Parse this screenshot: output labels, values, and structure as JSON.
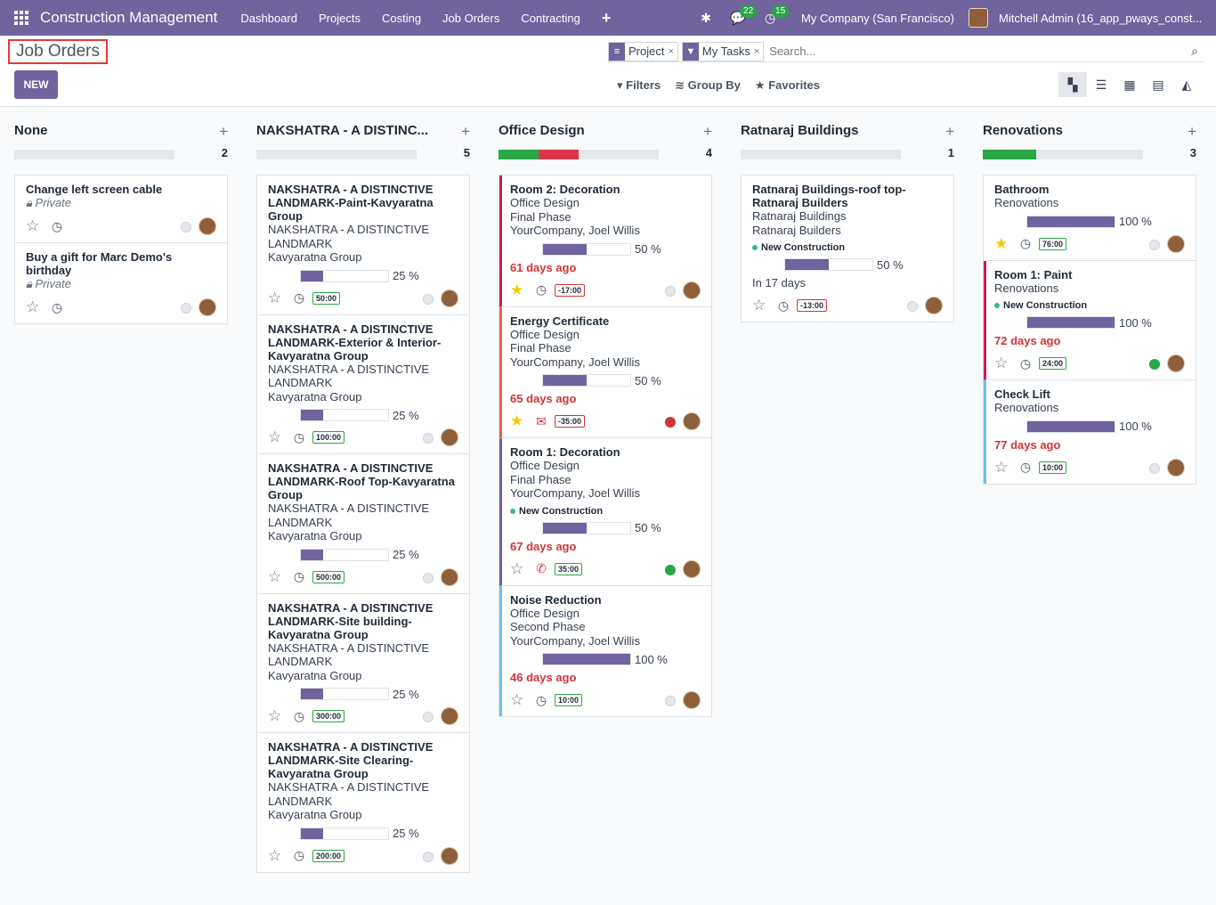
{
  "nav": {
    "app": "Construction Management",
    "menu": [
      "Dashboard",
      "Projects",
      "Costing",
      "Job Orders",
      "Contracting"
    ],
    "chat_count": "22",
    "activity_count": "15",
    "company": "My Company (San Francisco)",
    "user": "Mitchell Admin (16_app_pways_const..."
  },
  "page": {
    "title": "Job Orders",
    "new_label": "NEW"
  },
  "search": {
    "facets": [
      {
        "label": "Project"
      },
      {
        "label": "My Tasks"
      }
    ],
    "placeholder": "Search..."
  },
  "tools": {
    "filters": "Filters",
    "group_by": "Group By",
    "favorites": "Favorites"
  },
  "colors": {
    "accent": "#71639e",
    "success": "#28a745",
    "danger": "#d13438",
    "warning": "#f3cc00"
  },
  "columns": [
    {
      "name": "None",
      "count": "2",
      "progress": [],
      "cards": [
        {
          "lines": [
            "Change left screen cable"
          ],
          "private": "Private",
          "star": false,
          "act": "clock",
          "hours": "",
          "state": "grey"
        },
        {
          "lines": [
            "Buy a gift for Marc Demo's birthday"
          ],
          "private": "Private",
          "star": false,
          "act": "clock",
          "hours": "",
          "state": "grey"
        }
      ]
    },
    {
      "name": "NAKSHATRA - A DISTINC...",
      "count": "5",
      "progress": [],
      "cards": [
        {
          "title": "NAKSHATRA - A DISTINCTIVE LANDMARK-Paint-Kavyaratna Group",
          "lines": [
            "NAKSHATRA - A DISTINCTIVE LANDMARK",
            "Kavyaratna Group"
          ],
          "pct": 25,
          "pct_label": "25 %",
          "star": false,
          "act": "clock",
          "hours": "50:00",
          "state": "grey"
        },
        {
          "title": "NAKSHATRA - A DISTINCTIVE LANDMARK-Exterior & Interior-Kavyaratna Group",
          "lines": [
            "NAKSHATRA - A DISTINCTIVE LANDMARK",
            "Kavyaratna Group"
          ],
          "pct": 25,
          "pct_label": "25 %",
          "star": false,
          "act": "clock",
          "hours": "100:00",
          "state": "grey"
        },
        {
          "title": "NAKSHATRA - A DISTINCTIVE LANDMARK-Roof Top-Kavyaratna Group",
          "lines": [
            "NAKSHATRA - A DISTINCTIVE LANDMARK",
            "Kavyaratna Group"
          ],
          "pct": 25,
          "pct_label": "25 %",
          "star": false,
          "act": "clock",
          "hours": "500:00",
          "state": "grey"
        },
        {
          "title": "NAKSHATRA - A DISTINCTIVE LANDMARK-Site building-Kavyaratna Group",
          "lines": [
            "NAKSHATRA - A DISTINCTIVE LANDMARK",
            "Kavyaratna Group"
          ],
          "pct": 25,
          "pct_label": "25 %",
          "star": false,
          "act": "clock",
          "hours": "300:00",
          "state": "grey"
        },
        {
          "title": "NAKSHATRA - A DISTINCTIVE LANDMARK-Site Clearing-Kavyaratna Group",
          "lines": [
            "NAKSHATRA - A DISTINCTIVE LANDMARK",
            "Kavyaratna Group"
          ],
          "pct": 25,
          "pct_label": "25 %",
          "star": false,
          "act": "clock",
          "hours": "200:00",
          "state": "grey"
        }
      ]
    },
    {
      "name": "Office Design",
      "count": "4",
      "progress": [
        {
          "color": "#28a745",
          "frac": 0.25
        },
        {
          "color": "#dc3545",
          "frac": 0.25
        }
      ],
      "cards": [
        {
          "color": "#c81e5b",
          "title": "Room 2: Decoration",
          "lines": [
            "Office Design",
            "Final Phase",
            "YourCompany, Joel Willis"
          ],
          "pct": 50,
          "pct_label": "50 %",
          "ago": "61 days ago",
          "star": true,
          "act": "clock",
          "hours": "-17:00",
          "state": "grey"
        },
        {
          "color": "#f06050",
          "title": "Energy Certificate",
          "lines": [
            "Office Design",
            "Final Phase",
            "YourCompany, Joel Willis"
          ],
          "pct": 50,
          "pct_label": "50 %",
          "ago": "65 days ago",
          "star": true,
          "act": "envelope",
          "hours": "-35:00",
          "state": "red"
        },
        {
          "color": "#71639e",
          "title": "Room 1: Decoration",
          "lines": [
            "Office Design",
            "Final Phase",
            "YourCompany, Joel Willis"
          ],
          "tag": "New Construction",
          "pct": 50,
          "pct_label": "50 %",
          "ago": "67 days ago",
          "star": false,
          "act": "phone",
          "hours": "35:00",
          "state": "green"
        },
        {
          "color": "#6cc1ed",
          "title": "Noise Reduction",
          "lines": [
            "Office Design",
            "Second Phase",
            "YourCompany, Joel Willis"
          ],
          "pct": 100,
          "pct_label": "100 %",
          "ago": "46 days ago",
          "star": false,
          "act": "clock",
          "hours": "10:00",
          "state": "grey"
        }
      ]
    },
    {
      "name": "Ratnaraj Buildings",
      "count": "1",
      "progress": [],
      "cards": [
        {
          "title": "Ratnaraj Buildings-roof top-Ratnaraj Builders",
          "lines": [
            "Ratnaraj Buildings",
            "Ratnaraj Builders"
          ],
          "tag": "New Construction",
          "pct": 50,
          "pct_label": "50 %",
          "days": "In 17 days",
          "star": false,
          "act": "clock",
          "hours": "-13:00",
          "state": "grey"
        }
      ]
    },
    {
      "name": "Renovations",
      "count": "3",
      "progress": [
        {
          "color": "#28a745",
          "frac": 0.333
        }
      ],
      "cards": [
        {
          "title": "Bathroom",
          "lines": [
            "Renovations"
          ],
          "pct": 100,
          "pct_label": "100 %",
          "star": true,
          "act": "clock",
          "hours": "76:00",
          "state": "grey"
        },
        {
          "color": "#c81e5b",
          "title": "Room 1: Paint",
          "lines": [
            "Renovations"
          ],
          "tag": "New Construction",
          "pct": 100,
          "pct_label": "100 %",
          "ago": "72 days ago",
          "star": false,
          "act": "clock",
          "hours": "24:00",
          "state": "green"
        },
        {
          "color": "#6cc1ed",
          "title": "Check Lift",
          "lines": [
            "Renovations"
          ],
          "pct": 100,
          "pct_label": "100 %",
          "ago": "77 days ago",
          "star": false,
          "act": "clock",
          "hours": "10:00",
          "state": "grey"
        }
      ]
    }
  ]
}
